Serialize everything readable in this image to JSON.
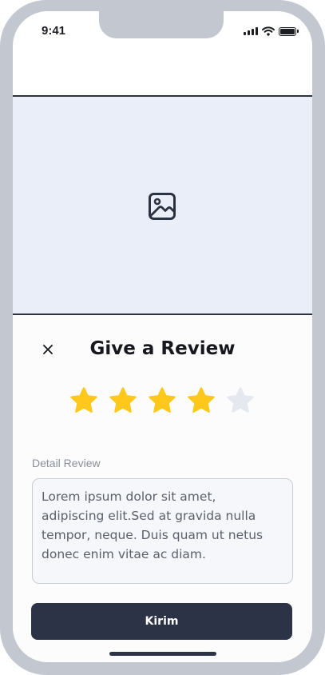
{
  "status_bar": {
    "time": "9:41"
  },
  "image_placeholder": {
    "icon": "image-icon",
    "background": "#eaeef8"
  },
  "review": {
    "title": "Give a Review",
    "close_icon": "close-icon",
    "rating": 4,
    "max_rating": 5,
    "star_active_color": "#ffc81b",
    "star_inactive_color": "#e5e8ee",
    "detail_label": "Detail Review",
    "detail_text": "Lorem ipsum dolor sit amet,  adipiscing elit.Sed at gravida nulla tempor, neque. Duis quam ut netus donec enim vitae ac diam.",
    "submit_label": "Kirim"
  },
  "colors": {
    "primary": "#2c3346",
    "frame": "#c2c7d0"
  }
}
